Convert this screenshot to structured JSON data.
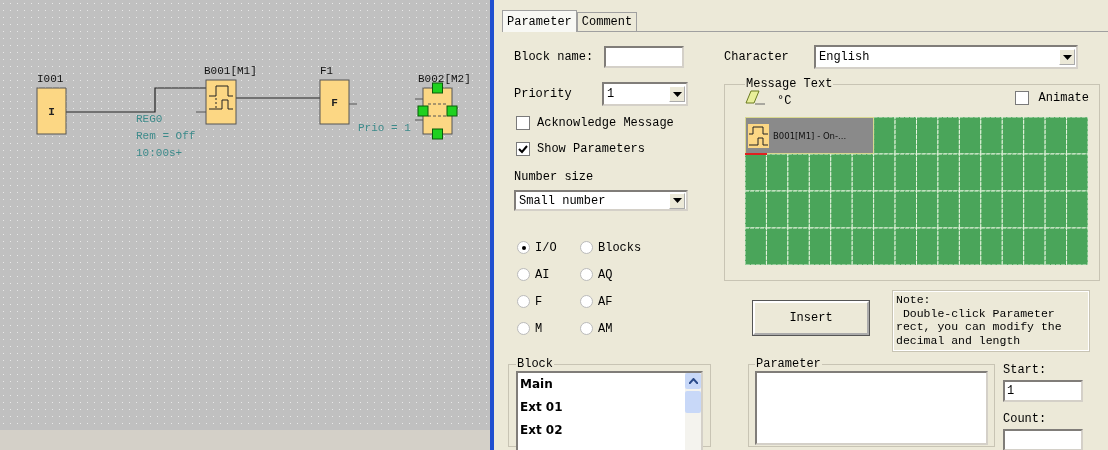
{
  "diagram": {
    "blocks": [
      {
        "kind": "input",
        "name": "I001",
        "symbol": "I"
      },
      {
        "kind": "timer",
        "name": "B001[M1]",
        "params": [
          "REG0",
          "Rem = Off",
          "10:00s+"
        ]
      },
      {
        "kind": "flag",
        "name": "F1",
        "symbol": "F"
      },
      {
        "kind": "message",
        "name": "B002[M2]",
        "selected": true,
        "prio": "Prio = 1"
      }
    ]
  },
  "tabs": [
    {
      "label": "Parameter",
      "selected": true
    },
    {
      "label": "Comment",
      "selected": false
    }
  ],
  "block_name": {
    "label": "Block name:"
  },
  "priority": {
    "label": "Priority",
    "value": "1"
  },
  "checkboxes": [
    {
      "label": "Acknowledge Message",
      "checked": false
    },
    {
      "label": "Show Parameters",
      "checked": true
    }
  ],
  "number_size": {
    "label": "Number size",
    "value": "Small number"
  },
  "radios": [
    {
      "label": "I/O",
      "selected": true
    },
    {
      "label": "Blocks",
      "selected": false
    },
    {
      "label": "AI",
      "selected": false
    },
    {
      "label": "AQ",
      "selected": false
    },
    {
      "label": "F",
      "selected": false
    },
    {
      "label": "AF",
      "selected": false
    },
    {
      "label": "M",
      "selected": false
    },
    {
      "label": "AM",
      "selected": false
    }
  ],
  "block_list": {
    "title": "Block",
    "items": [
      "Main",
      "Ext 01",
      "Ext 02"
    ]
  },
  "character": {
    "label": "Character",
    "value": "English"
  },
  "message_text": {
    "title": "Message Text",
    "unit": "°C",
    "animate": {
      "label": "Animate",
      "checked": false
    },
    "parameter_cell": "B001[M1] - On-..."
  },
  "insert_button": "Insert",
  "note": "Note:\n Double-click Parameter\nrect, you can modify the\ndecimal and length",
  "parameter": {
    "title": "Parameter"
  },
  "start": {
    "label": "Start:",
    "value": "1"
  },
  "count": {
    "label": "Count:"
  }
}
